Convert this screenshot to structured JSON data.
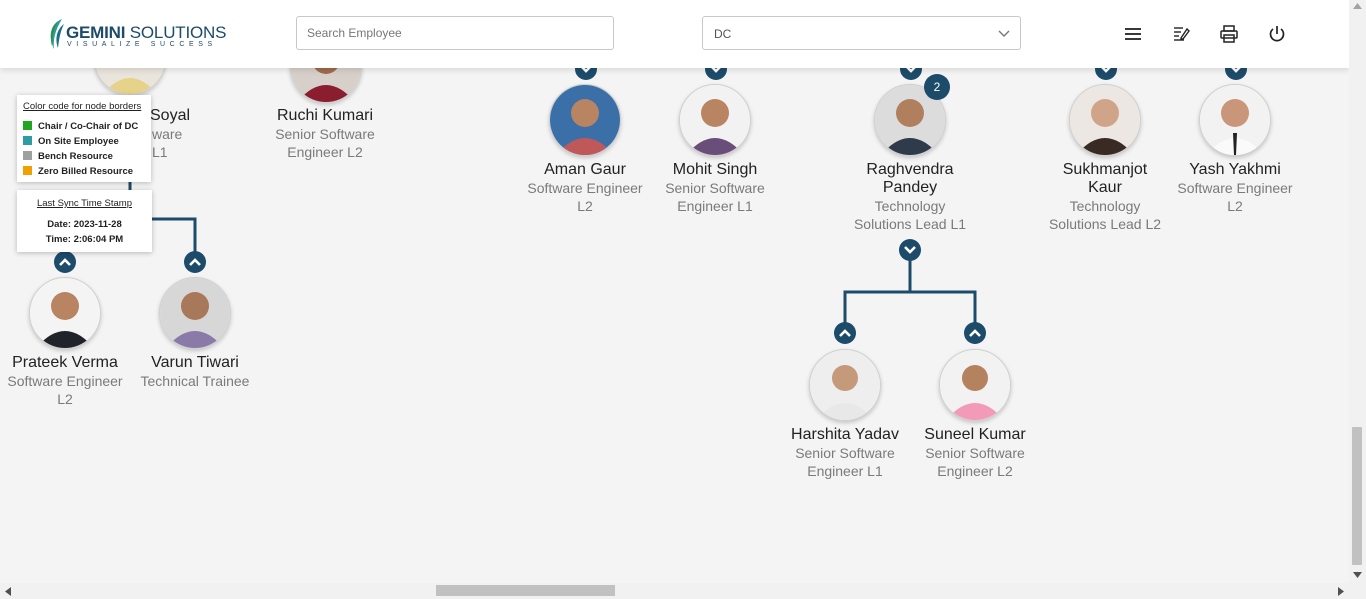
{
  "header": {
    "logo": {
      "name_bold": "GEMINI",
      "name_rest": " SOLUTIONS",
      "tagline": "VISUALIZE SUCCESS"
    },
    "search_placeholder": "Search Employee",
    "department_select": {
      "value": "DC"
    },
    "icons": [
      "menu-icon",
      "edit-note-icon",
      "print-icon",
      "power-icon"
    ]
  },
  "legend": {
    "title": "Color code for node borders",
    "items": [
      {
        "label": "Chair / Co-Chair of DC",
        "color": "#1fa81f"
      },
      {
        "label": "On Site Employee",
        "color": "#2e9ca3"
      },
      {
        "label": "Bench Resource",
        "color": "#a0a0a0"
      },
      {
        "label": "Zero Billed Resource",
        "color": "#f0a000"
      }
    ]
  },
  "sync": {
    "title": "Last Sync Time Stamp",
    "date": "Date: 2023-11-28",
    "time": "Time: 2:06:04 PM"
  },
  "partial_node": {
    "name_fragment": "Soyal",
    "role_fragment_1": "ware",
    "role_fragment_2": "L1"
  },
  "nodes": {
    "ruchi": {
      "name": "Ruchi Kumari",
      "role1": "Senior Software",
      "role2": "Engineer L2"
    },
    "aman": {
      "name": "Aman Gaur",
      "role1": "Software Engineer",
      "role2": "L2"
    },
    "mohit": {
      "name": "Mohit Singh",
      "role1": "Senior Software",
      "role2": "Engineer L1"
    },
    "raghvendra": {
      "name1": "Raghvendra",
      "name2": "Pandey",
      "role1": "Technology",
      "role2": "Solutions Lead L1",
      "reports_count": "2"
    },
    "sukhmanjot": {
      "name1": "Sukhmanjot",
      "name2": "Kaur",
      "role1": "Technology",
      "role2": "Solutions Lead L2"
    },
    "yash": {
      "name": "Yash Yakhmi",
      "role1": "Software Engineer",
      "role2": "L2"
    },
    "prateek": {
      "name": "Prateek Verma",
      "role1": "Software Engineer",
      "role2": "L2"
    },
    "varun": {
      "name": "Varun Tiwari",
      "role1": "Technical Trainee",
      "role2": ""
    },
    "harshita": {
      "name": "Harshita Yadav",
      "role1": "Senior Software",
      "role2": "Engineer L1"
    },
    "suneel": {
      "name": "Suneel Kumar",
      "role1": "Senior Software",
      "role2": "Engineer L2"
    }
  },
  "colors": {
    "accent": "#1d4b6a",
    "connector": "#1d4b6a"
  }
}
